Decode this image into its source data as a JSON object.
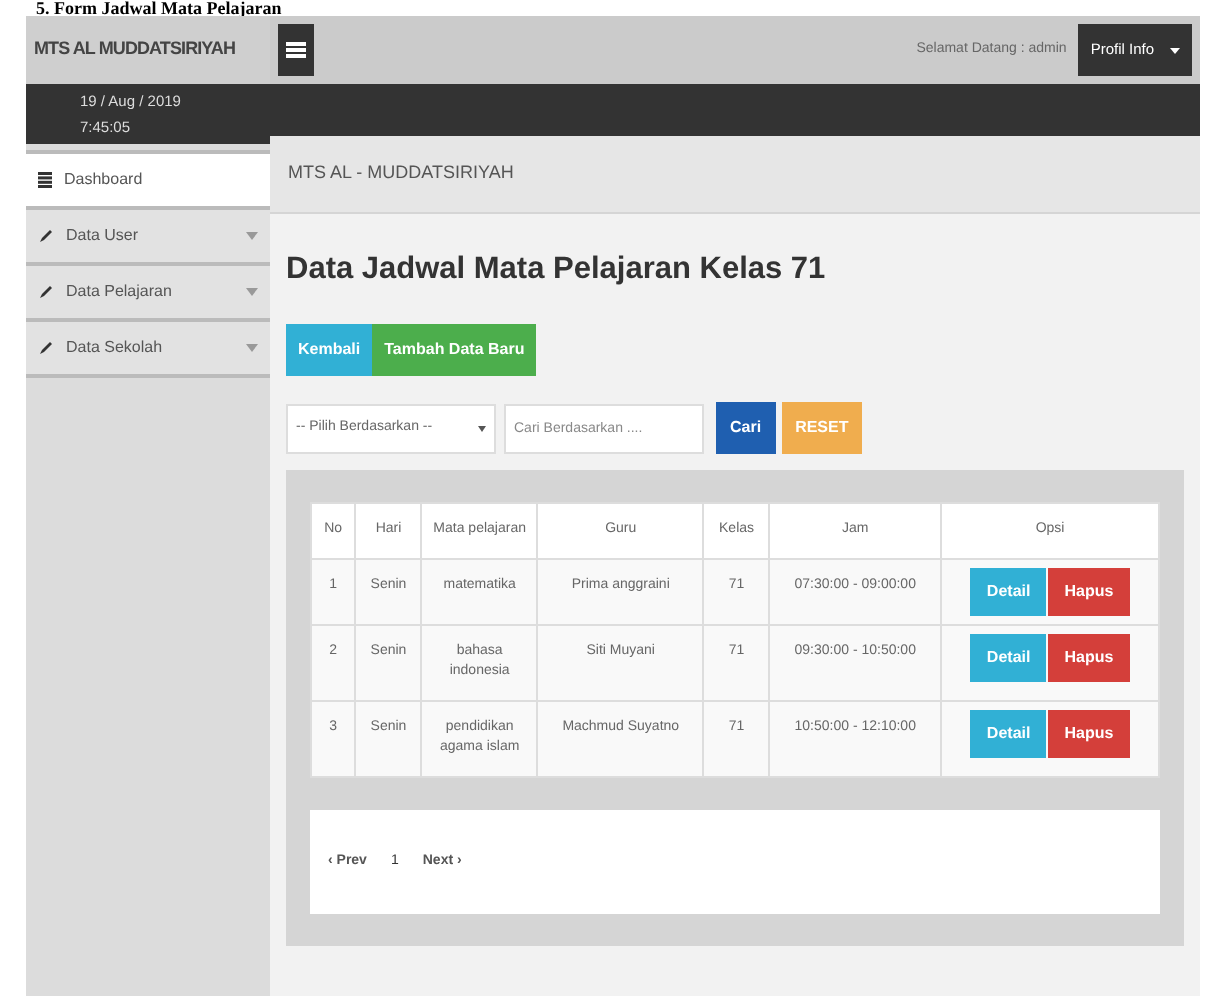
{
  "caption": "5. Form Jadwal Mata Pelajaran",
  "brand": "MTS AL MUDDATSIRIYAH",
  "date": "19 / Aug / 2019",
  "time": "7:45:05",
  "greeting": "Selamat Datang : admin",
  "profile_button": "Profil Info",
  "sidebar": {
    "items": [
      {
        "label": "Dashboard",
        "kind": "list",
        "selected": true
      },
      {
        "label": "Data User",
        "kind": "pencil",
        "selected": false
      },
      {
        "label": "Data Pelajaran",
        "kind": "pencil",
        "selected": false
      },
      {
        "label": "Data Sekolah",
        "kind": "pencil",
        "selected": false
      }
    ]
  },
  "breadcrumb": "MTS AL - MUDDATSIRIYAH",
  "heading": "Data Jadwal Mata Pelajaran Kelas 71",
  "buttons": [
    {
      "label": "Kembali",
      "kind": "info"
    },
    {
      "label": "Tambah Data Baru",
      "kind": "success"
    }
  ],
  "search": {
    "select": "-- Pilih Berdasarkan --",
    "placeholder": "Cari Berdasarkan ....",
    "buttons": [
      {
        "label": "Cari",
        "kind": "primary"
      },
      {
        "label": "RESET",
        "kind": "warning"
      }
    ]
  },
  "table": {
    "columns": [
      "No",
      "Hari",
      "Mata pelajaran",
      "Guru",
      "Kelas",
      "Jam",
      "Opsi"
    ],
    "rows": [
      {
        "cells": [
          "1",
          "Senin",
          "matematika",
          "Prima anggraini",
          "71",
          "07:30:00 - 09:00:00"
        ],
        "actions": [
          "Detail",
          "Hapus"
        ]
      },
      {
        "cells": [
          "2",
          "Senin",
          "bahasa indonesia",
          "Siti Muyani",
          "71",
          "09:30:00 - 10:50:00"
        ],
        "actions": [
          "Detail",
          "Hapus"
        ]
      },
      {
        "cells": [
          "3",
          "Senin",
          "pendidikan agama islam",
          "Machmud Suyatno",
          "71",
          "10:50:00 - 12:10:00"
        ],
        "actions": [
          "Detail",
          "Hapus"
        ]
      }
    ]
  },
  "pagination": [
    {
      "label": "‹ Prev",
      "selected": false
    },
    {
      "label": "1",
      "selected": true
    },
    {
      "label": "Next ›",
      "selected": false
    }
  ]
}
